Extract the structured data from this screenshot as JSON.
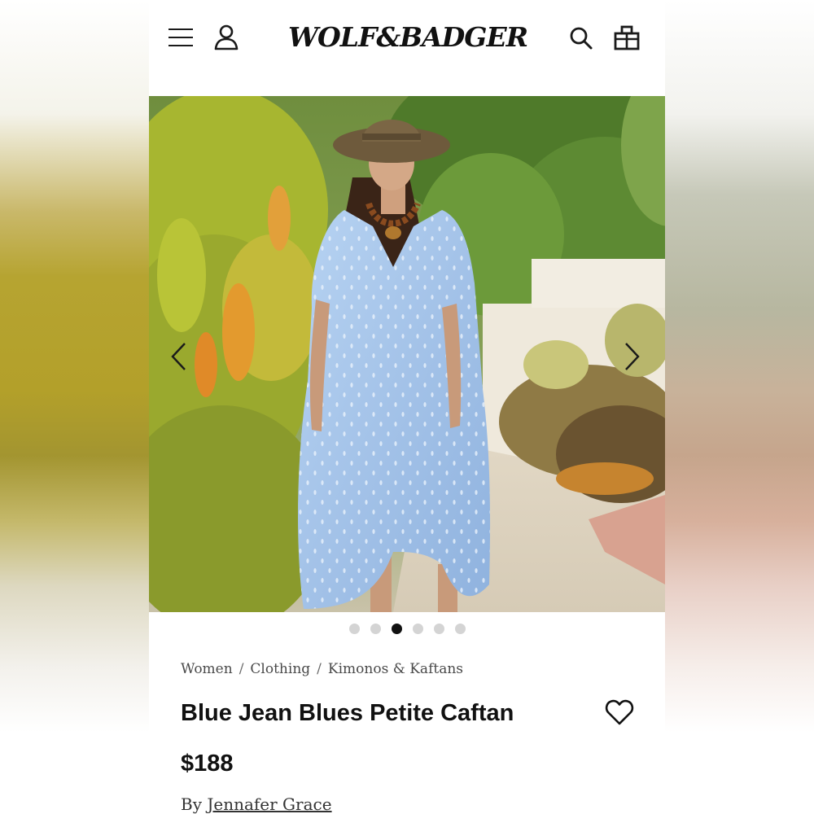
{
  "header": {
    "logo_text": "WOLF&BADGER",
    "icons": [
      "menu-icon",
      "account-icon",
      "search-icon",
      "shopping-bag-icon"
    ]
  },
  "gallery": {
    "dots_count": 6,
    "active_index": 2,
    "icons": [
      "chevron-left-icon",
      "chevron-right-icon"
    ]
  },
  "breadcrumb": {
    "items": [
      "Women",
      "Clothing",
      "Kimonos & Kaftans"
    ],
    "separator": "/"
  },
  "product": {
    "title": "Blue Jean Blues Petite Caftan",
    "price": "$188",
    "by_prefix": "By",
    "designer": "Jennafer Grace",
    "wishlist_icon": "heart-icon"
  },
  "colors": {
    "text": "#111111",
    "dot_inactive": "#d4d4d4",
    "dot_active": "#111111",
    "caftan_blue": "#a9c8ec"
  }
}
